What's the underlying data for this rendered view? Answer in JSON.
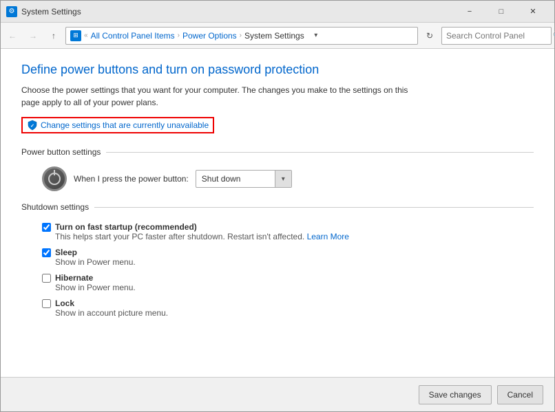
{
  "window": {
    "title": "System Settings",
    "title_icon": "⚙"
  },
  "titlebar": {
    "minimize_label": "−",
    "maximize_label": "□",
    "close_label": "✕"
  },
  "addressbar": {
    "back_icon": "←",
    "forward_icon": "→",
    "up_icon": "↑",
    "refresh_icon": "↻",
    "dropdown_icon": "▾",
    "breadcrumb": {
      "icon": "⊞",
      "parts": [
        {
          "label": "All Control Panel Items",
          "link": true
        },
        {
          "label": "Power Options",
          "link": true
        },
        {
          "label": "System Settings",
          "link": false
        }
      ]
    },
    "search": {
      "placeholder": "Search Control Panel",
      "icon": "🔍"
    }
  },
  "page": {
    "title": "Define power buttons and turn on password protection",
    "description_line1": "Choose the power settings that you want for your computer. The changes you make to the settings on this",
    "description_line2": "page apply to all of your power plans.",
    "change_settings_link": "Change settings that are currently unavailable",
    "power_button_section": {
      "label": "Power button settings",
      "row_label": "When I press the power button:",
      "dropdown_value": "Shut down",
      "dropdown_arrow": "▾"
    },
    "shutdown_section": {
      "label": "Shutdown settings",
      "items": [
        {
          "id": "fast_startup",
          "checked": true,
          "label": "Turn on fast startup (recommended)",
          "desc_before": "This helps start your PC faster after shutdown. Restart isn't affected.",
          "learn_more": "Learn More",
          "bold": true
        },
        {
          "id": "sleep",
          "checked": true,
          "label": "Sleep",
          "desc": "Show in Power menu.",
          "bold": false
        },
        {
          "id": "hibernate",
          "checked": false,
          "label": "Hibernate",
          "desc": "Show in Power menu.",
          "bold": false
        },
        {
          "id": "lock",
          "checked": false,
          "label": "Lock",
          "desc": "Show in account picture menu.",
          "bold": false
        }
      ]
    }
  },
  "footer": {
    "save_label": "Save changes",
    "cancel_label": "Cancel"
  }
}
